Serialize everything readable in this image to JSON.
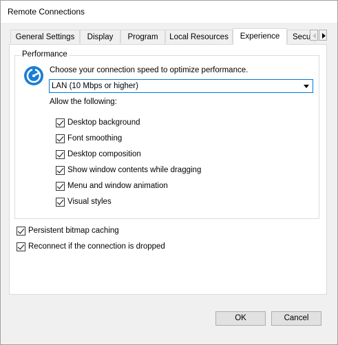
{
  "window": {
    "title": "Remote Connections"
  },
  "tabs": [
    {
      "label": "General Settings"
    },
    {
      "label": "Display"
    },
    {
      "label": "Program"
    },
    {
      "label": "Local Resources"
    },
    {
      "label": "Experience",
      "active": true
    },
    {
      "label": "Secu"
    }
  ],
  "performance": {
    "group_label": "Performance",
    "prompt": "Choose your connection speed to optimize performance.",
    "icon": "speedometer-icon",
    "speed_select": {
      "value": "LAN (10 Mbps or higher)"
    },
    "allow_label": "Allow the following:",
    "options": [
      {
        "label": "Desktop background",
        "checked": true
      },
      {
        "label": "Font smoothing",
        "checked": true
      },
      {
        "label": "Desktop composition",
        "checked": true
      },
      {
        "label": "Show window contents while dragging",
        "checked": true
      },
      {
        "label": "Menu and window animation",
        "checked": true
      },
      {
        "label": "Visual styles",
        "checked": true
      }
    ]
  },
  "persistent_bitmap": {
    "label": "Persistent bitmap caching",
    "checked": true
  },
  "reconnect": {
    "label": "Reconnect if the connection is dropped",
    "checked": true
  },
  "buttons": {
    "ok": "OK",
    "cancel": "Cancel"
  },
  "colors": {
    "accent": "#0078d7",
    "icon_blue": "#1a7fd4"
  }
}
